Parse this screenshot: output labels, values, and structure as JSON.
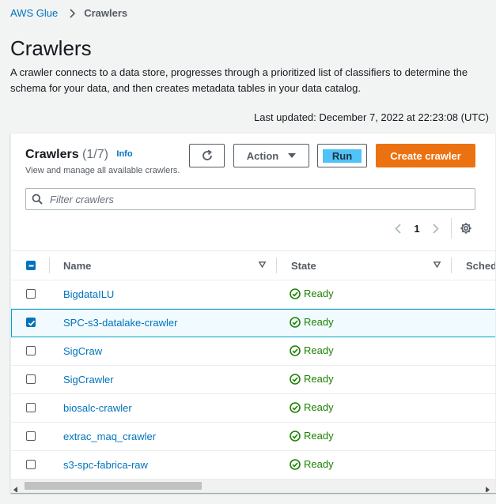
{
  "breadcrumb": {
    "root": "AWS Glue",
    "current": "Crawlers"
  },
  "page": {
    "title": "Crawlers",
    "description": "A crawler connects to a data store, progresses through a prioritized list of classifiers to determine the schema for your data, and then creates metadata tables in your data catalog.",
    "last_updated": "Last updated: December 7, 2022 at 22:23:08 (UTC)"
  },
  "panel": {
    "title": "Crawlers",
    "count": "(1/7)",
    "info": "Info",
    "subtitle": "View and manage all available crawlers.",
    "buttons": {
      "action": "Action",
      "run": "Run",
      "create": "Create crawler"
    },
    "filter_placeholder": "Filter crawlers",
    "pagination": {
      "current_page": "1"
    }
  },
  "table": {
    "columns": {
      "name": "Name",
      "state": "State",
      "schedule": "Schedule"
    },
    "rows": [
      {
        "name": "BigdataILU",
        "state": "Ready",
        "selected": false
      },
      {
        "name": "SPC-s3-datalake-crawler",
        "state": "Ready",
        "selected": true
      },
      {
        "name": "SigCraw",
        "state": "Ready",
        "selected": false
      },
      {
        "name": "SigCrawler",
        "state": "Ready",
        "selected": false
      },
      {
        "name": "biosalc-crawler",
        "state": "Ready",
        "selected": false
      },
      {
        "name": "extrac_maq_crawler",
        "state": "Ready",
        "selected": false
      },
      {
        "name": "s3-spc-fabrica-raw",
        "state": "Ready",
        "selected": false
      }
    ]
  },
  "colors": {
    "link": "#0073bb",
    "primary": "#ec7211",
    "success": "#1d8102",
    "highlight": "#4fc3f7"
  },
  "icons": [
    "chevron-right-icon",
    "refresh-icon",
    "caret-down-icon",
    "search-icon",
    "settings-icon",
    "status-success-icon"
  ]
}
